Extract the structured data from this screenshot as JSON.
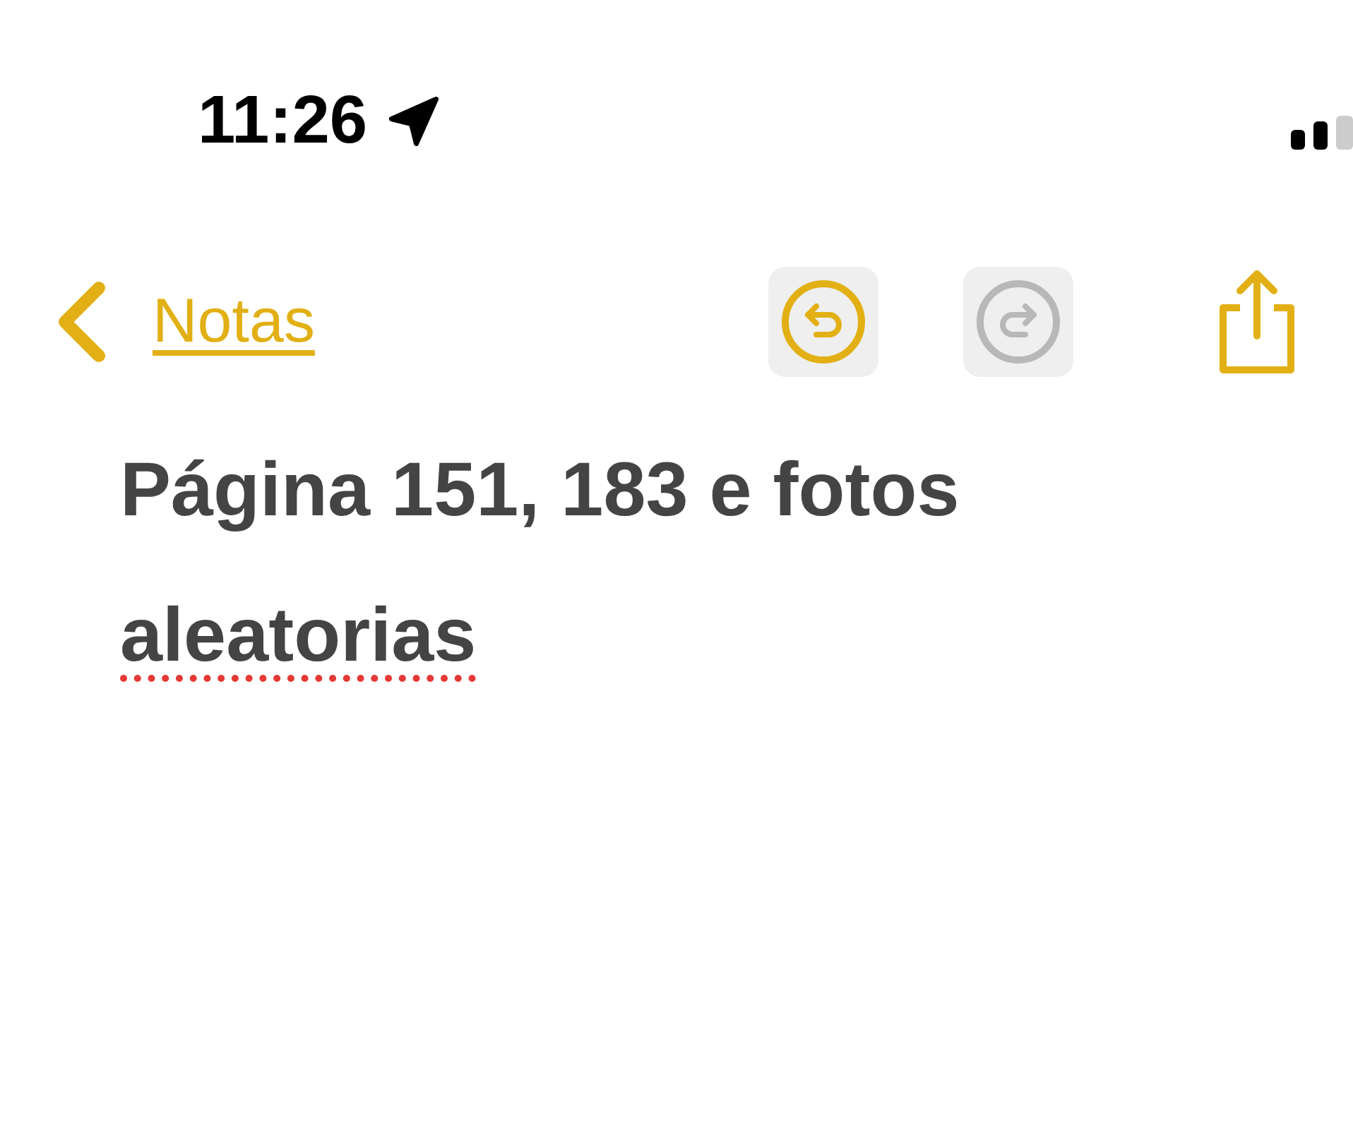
{
  "status_bar": {
    "time": "11:26"
  },
  "nav": {
    "back_label": "Notas",
    "undo": {
      "disabled": false
    },
    "redo": {
      "disabled": true
    }
  },
  "note": {
    "title": [
      {
        "text": "Página 151, 183 e fotos ",
        "misspelled": false
      },
      {
        "text": "aleatorias",
        "misspelled": true
      }
    ]
  }
}
